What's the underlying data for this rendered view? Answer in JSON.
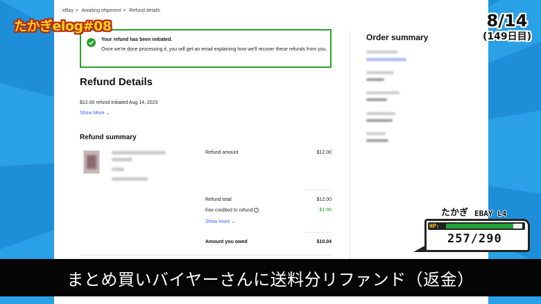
{
  "breadcrumb": [
    "eBay",
    "Awaiting shipment",
    "Refund details"
  ],
  "banner": {
    "title": "Your refund has been initiated.",
    "body": "Once we're done processing it, you will get an email explaining how we'll recover these refunds from you."
  },
  "refund_details": {
    "heading": "Refund Details",
    "initiated": "$12.00 refund initiated Aug 14, 2023",
    "show_more": "Show More"
  },
  "refund_summary": {
    "heading": "Refund summary",
    "refund_amount_label": "Refund amount",
    "refund_amount_value": "$12.00",
    "refund_total_label": "Refund total",
    "refund_total_value": "$12.00",
    "fee_label": "Fee credited to refund",
    "fee_value": "-$1.96",
    "show_more": "Show more",
    "owed_label": "Amount you owed",
    "owed_value": "$10.04"
  },
  "order_summary": {
    "heading": "Order summary"
  },
  "overlay": {
    "logo": "たかぎelog#08",
    "date": "8/14",
    "day_count": "(149日目)",
    "hp_name": "たかぎ",
    "hp_level": "EBAY L4",
    "hp_tag": "HP:",
    "hp_current": "257",
    "hp_max": "290",
    "hp_fraction": 0.886,
    "subtitle": "まとめ買いバイヤーさんに送料分リファンド（返金）"
  },
  "colors": {
    "background": "#1f8ed8",
    "success_green": "#2aa12a",
    "link_blue": "#3665f3",
    "logo_yellow": "#ffd21f"
  }
}
